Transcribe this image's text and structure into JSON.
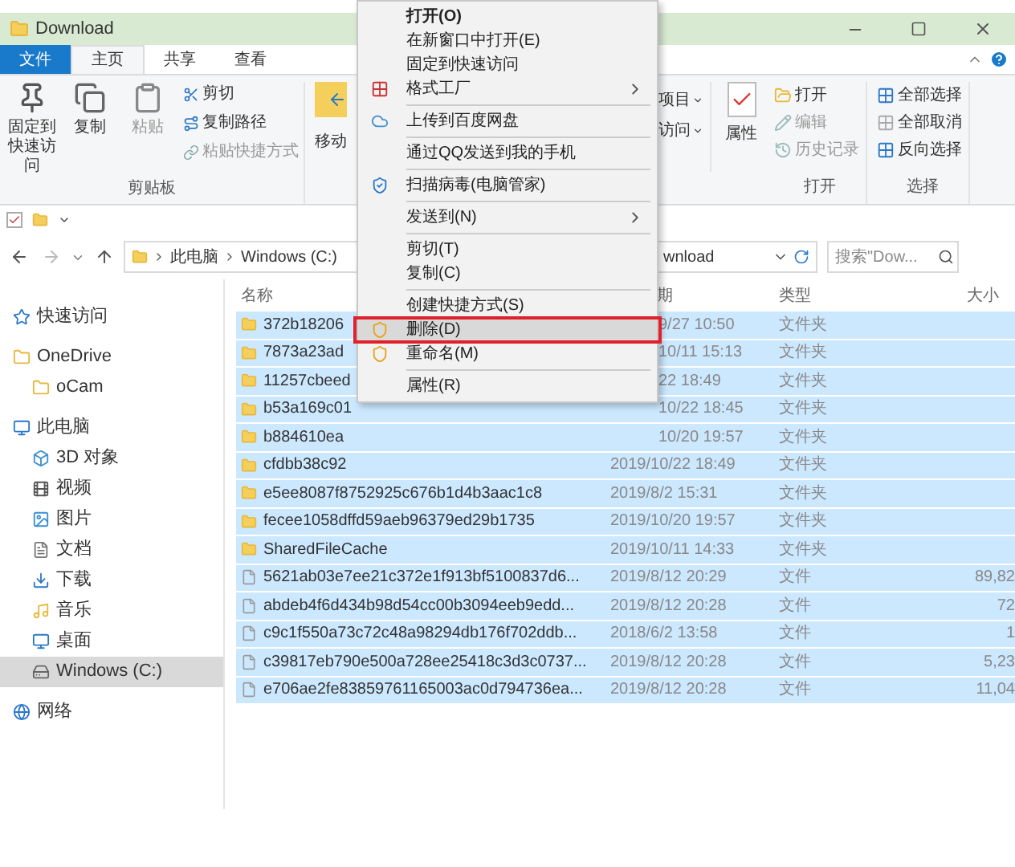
{
  "window": {
    "title": "Download"
  },
  "ribbon_tabs": [
    {
      "label": "文件",
      "kind": "file",
      "selected": false
    },
    {
      "label": "主页",
      "kind": "tab",
      "selected": true
    },
    {
      "label": "共享",
      "kind": "tab",
      "selected": false
    },
    {
      "label": "查看",
      "kind": "tab",
      "selected": false
    }
  ],
  "clipboard_group": {
    "large_buttons": [
      {
        "label": "固定到快速访问",
        "disabled": false
      },
      {
        "label": "复制",
        "disabled": false
      },
      {
        "label": "粘贴",
        "disabled": true
      }
    ],
    "small_buttons": [
      {
        "label": "剪切",
        "disabled": false
      },
      {
        "label": "复制路径",
        "disabled": false
      },
      {
        "label": "粘贴快捷方式",
        "disabled": true
      }
    ],
    "caption": "剪贴板"
  },
  "move_button": {
    "label": "移动"
  },
  "new_group": {
    "buttons": [
      {
        "label": "项目"
      },
      {
        "label": "访问"
      }
    ]
  },
  "properties_button": {
    "label": "属性"
  },
  "open_group": {
    "buttons": [
      {
        "label": "打开",
        "disabled": false
      },
      {
        "label": "编辑",
        "disabled": true
      },
      {
        "label": "历史记录",
        "disabled": true
      }
    ],
    "caption": "打开"
  },
  "select_group": {
    "buttons": [
      {
        "label": "全部选择"
      },
      {
        "label": "全部取消"
      },
      {
        "label": "反向选择"
      }
    ],
    "caption": "选择"
  },
  "address": {
    "crumbs": [
      "此电脑",
      "Windows (C:)"
    ],
    "tail": "wnload"
  },
  "search": {
    "placeholder": "搜索\"Dow..."
  },
  "sidebar": {
    "items": [
      {
        "label": "快速访问",
        "selected": false
      },
      {
        "label": "OneDrive",
        "selected": false,
        "children": [
          {
            "label": "oCam",
            "selected": false
          }
        ]
      },
      {
        "label": "此电脑",
        "selected": false,
        "children": [
          {
            "label": "3D 对象",
            "selected": false
          },
          {
            "label": "视频",
            "selected": false
          },
          {
            "label": "图片",
            "selected": false
          },
          {
            "label": "文档",
            "selected": false
          },
          {
            "label": "下载",
            "selected": false
          },
          {
            "label": "音乐",
            "selected": false
          },
          {
            "label": "桌面",
            "selected": false
          },
          {
            "label": "Windows (C:)",
            "selected": true
          }
        ]
      },
      {
        "label": "网络",
        "selected": false
      }
    ]
  },
  "table": {
    "columns": [
      "名称",
      "期",
      "类型",
      "大小"
    ],
    "rows": [
      {
        "kind": "folder",
        "name": "372b18206",
        "date": "9/27 10:50",
        "type": "文件夹",
        "selected": true
      },
      {
        "kind": "folder",
        "name": "7873a23ad",
        "date": "10/11 15:13",
        "type": "文件夹",
        "selected": true
      },
      {
        "kind": "folder",
        "name": "11257cbeed",
        "date": "22 18:49",
        "type": "文件夹",
        "selected": true
      },
      {
        "kind": "folder",
        "name": "b53a169c01",
        "date": "10/22 18:45",
        "type": "文件夹",
        "selected": true
      },
      {
        "kind": "folder",
        "name": "b884610ea",
        "date": "10/20 19:57",
        "type": "文件夹",
        "selected": true
      },
      {
        "kind": "folder",
        "name": "cfdbb38c92",
        "date": "2019/10/22 18:49",
        "type": "文件夹",
        "selected": true
      },
      {
        "kind": "folder",
        "name": "e5ee8087f8752925c676b1d4b3aac1c8",
        "date": "2019/8/2 15:31",
        "type": "文件夹",
        "selected": true
      },
      {
        "kind": "folder",
        "name": "fecee1058dffd59aeb96379ed29b1735",
        "date": "2019/10/20 19:57",
        "type": "文件夹",
        "selected": true
      },
      {
        "kind": "folder",
        "name": "SharedFileCache",
        "date": "2019/10/11 14:33",
        "type": "文件夹",
        "selected": true
      },
      {
        "kind": "file",
        "name": "5621ab03e7ee21c372e1f913bf5100837d6...",
        "date": "2019/8/12 20:29",
        "type": "文件",
        "size": "89,82",
        "selected": true
      },
      {
        "kind": "file",
        "name": "abdeb4f6d434b98d54cc00b3094eeb9edd...",
        "date": "2019/8/12 20:28",
        "type": "文件",
        "size": "72",
        "selected": true
      },
      {
        "kind": "file",
        "name": "c9c1f550a73c72c48a98294db176f702ddb...",
        "date": "2018/6/2 13:58",
        "type": "文件",
        "size": "1",
        "selected": true
      },
      {
        "kind": "file",
        "name": "c39817eb790e500a728ee25418c3d3c0737...",
        "date": "2019/8/12 20:28",
        "type": "文件",
        "size": "5,23",
        "selected": true
      },
      {
        "kind": "file",
        "name": "e706ae2fe83859761165003ac0d794736ea...",
        "date": "2019/8/12 20:28",
        "type": "文件",
        "size": "11,04",
        "selected": true
      }
    ]
  },
  "context_menu": {
    "items": [
      {
        "kind": "item",
        "label": "打开(O)",
        "bold": true,
        "submenu": false,
        "highlighted": false
      },
      {
        "kind": "item",
        "label": "在新窗口中打开(E)",
        "bold": false,
        "submenu": false,
        "highlighted": false
      },
      {
        "kind": "item",
        "label": "固定到快速访问",
        "bold": false,
        "submenu": false,
        "highlighted": false
      },
      {
        "kind": "item",
        "label": "格式工厂",
        "bold": false,
        "submenu": true,
        "highlighted": false
      },
      {
        "kind": "separator"
      },
      {
        "kind": "item",
        "label": "上传到百度网盘",
        "bold": false,
        "submenu": false,
        "highlighted": false
      },
      {
        "kind": "separator"
      },
      {
        "kind": "item",
        "label": "通过QQ发送到我的手机",
        "bold": false,
        "submenu": false,
        "highlighted": false
      },
      {
        "kind": "separator"
      },
      {
        "kind": "item",
        "label": "扫描病毒(电脑管家)",
        "bold": false,
        "submenu": false,
        "highlighted": false
      },
      {
        "kind": "separator"
      },
      {
        "kind": "item",
        "label": "发送到(N)",
        "bold": false,
        "submenu": true,
        "highlighted": false
      },
      {
        "kind": "separator"
      },
      {
        "kind": "item",
        "label": "剪切(T)",
        "bold": false,
        "submenu": false,
        "highlighted": false
      },
      {
        "kind": "item",
        "label": "复制(C)",
        "bold": false,
        "submenu": false,
        "highlighted": false
      },
      {
        "kind": "separator"
      },
      {
        "kind": "item",
        "label": "创建快捷方式(S)",
        "bold": false,
        "submenu": false,
        "highlighted": false
      },
      {
        "kind": "item",
        "label": "删除(D)",
        "bold": false,
        "submenu": false,
        "highlighted": true
      },
      {
        "kind": "item",
        "label": "重命名(M)",
        "bold": false,
        "submenu": false,
        "highlighted": false
      },
      {
        "kind": "separator"
      },
      {
        "kind": "item",
        "label": "属性(R)",
        "bold": false,
        "submenu": false,
        "highlighted": false
      }
    ]
  }
}
